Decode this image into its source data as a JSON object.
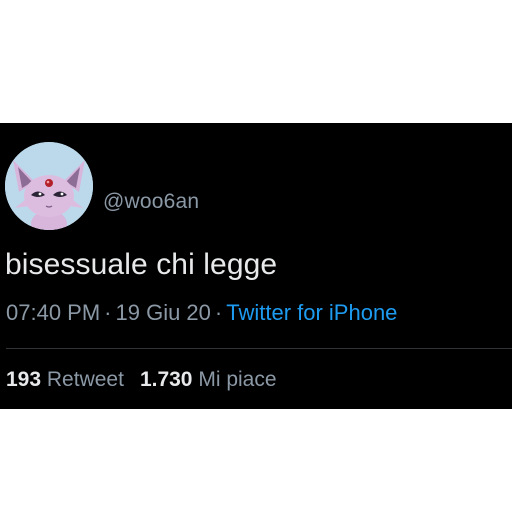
{
  "tweet": {
    "avatar_icon": "espeon-avatar-icon",
    "handle": "@woo6an",
    "text": "bisessuale chi legge",
    "time": "07:40 PM",
    "separator": "·",
    "date": "19 Giu 20",
    "source": "Twitter for iPhone",
    "retweets_count": "193",
    "retweets_label": "Retweet",
    "likes_count": "1.730",
    "likes_label": "Mi piace"
  },
  "colors": {
    "background": "#000000",
    "text": "#e7e9ea",
    "secondary": "#8b98a5",
    "accent": "#1d9bf0",
    "divider": "#2f3336"
  }
}
